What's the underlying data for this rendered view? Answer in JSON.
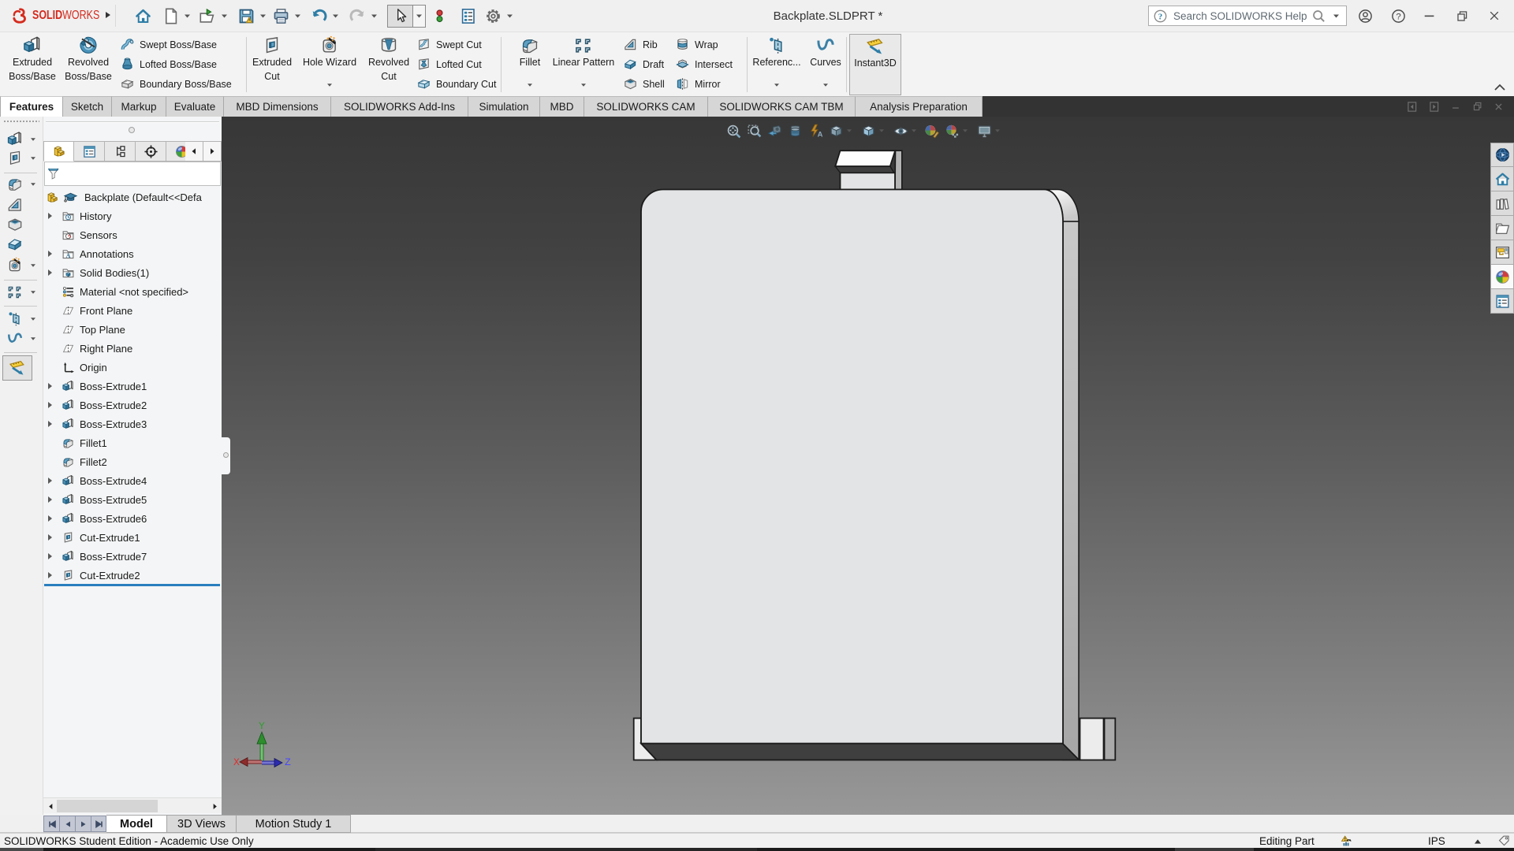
{
  "colors": {
    "brand_red": "#d52b1e",
    "rollback_blue": "#2a7fbe",
    "viewport_top": "#353535",
    "viewport_bottom": "#a6a6a6",
    "part": {
      "face": "#e3e4e6",
      "side_band": "#b4b4b4",
      "side_band_top": "#c9c9c9",
      "bottom_face": "#3f3f3f",
      "cap_top": "#fdfdfd",
      "flange": "#ececec",
      "outline": "#1a1a1a"
    },
    "triad": {
      "x_axis": "#c23b3b",
      "y_axis": "#2f9e2f",
      "z_axis": "#2b3bd0"
    }
  },
  "titlebar": {
    "brand_solid": "SOLID",
    "brand_works": "WORKS",
    "document_title": "Backplate.SLDPRT *",
    "search_placeholder": "Search SOLIDWORKS Help",
    "qat": [
      {
        "name": "home",
        "icon": "home",
        "dropdown": false
      },
      {
        "name": "new-document",
        "icon": "new-doc",
        "dropdown": true
      },
      {
        "name": "open",
        "icon": "open",
        "dropdown": true
      },
      {
        "name": "save",
        "icon": "save",
        "dropdown": true
      },
      {
        "name": "print",
        "icon": "print",
        "dropdown": true
      },
      {
        "name": "undo",
        "icon": "undo",
        "dropdown": true
      },
      {
        "name": "redo",
        "icon": "redo",
        "dropdown": true
      },
      {
        "name": "select",
        "icon": "cursor",
        "dropdown": true,
        "pressed": true
      },
      {
        "name": "display-states",
        "icon": "lights",
        "dropdown": false
      },
      {
        "name": "file-properties",
        "icon": "report",
        "dropdown": false
      },
      {
        "name": "options",
        "icon": "gear",
        "dropdown": true
      }
    ]
  },
  "ribbon": {
    "big_buttons": [
      {
        "name": "extruded-boss-base",
        "icon": "extruded-boss",
        "line1": "Extruded",
        "line2": "Boss/Base",
        "dropdown": false
      },
      {
        "name": "revolved-boss-base",
        "icon": "revolved-boss",
        "line1": "Revolved",
        "line2": "Boss/Base",
        "dropdown": false
      },
      {
        "name": "extruded-cut",
        "icon": "extruded-cut",
        "line1": "Extruded",
        "line2": "Cut",
        "dropdown": false
      },
      {
        "name": "hole-wizard",
        "icon": "hole-wizard",
        "line1": "Hole Wizard",
        "line2": "",
        "dropdown": true
      },
      {
        "name": "revolved-cut",
        "icon": "revolved-cut",
        "line1": "Revolved",
        "line2": "Cut",
        "dropdown": false
      },
      {
        "name": "fillet",
        "icon": "fillet",
        "line1": "Fillet",
        "line2": "",
        "dropdown": true
      },
      {
        "name": "linear-pattern",
        "icon": "linear-pattern",
        "line1": "Linear Pattern",
        "line2": "",
        "dropdown": true
      },
      {
        "name": "reference-geometry",
        "icon": "ref-geometry",
        "line1": "Referenc...",
        "line2": "",
        "dropdown": true
      },
      {
        "name": "curves",
        "icon": "curves",
        "line1": "Curves",
        "line2": "",
        "dropdown": true
      },
      {
        "name": "instant3d",
        "icon": "instant3d",
        "line1": "Instant3D",
        "line2": "",
        "dropdown": false,
        "pressed": true
      }
    ],
    "small_buttons": [
      {
        "name": "swept-boss-base",
        "icon": "swept-boss",
        "label": "Swept Boss/Base"
      },
      {
        "name": "lofted-boss-base",
        "icon": "lofted-boss",
        "label": "Lofted Boss/Base"
      },
      {
        "name": "boundary-boss-base",
        "icon": "boundary-boss",
        "label": "Boundary Boss/Base"
      },
      {
        "name": "swept-cut",
        "icon": "swept-cut",
        "label": "Swept Cut"
      },
      {
        "name": "lofted-cut",
        "icon": "lofted-cut",
        "label": "Lofted Cut"
      },
      {
        "name": "boundary-cut",
        "icon": "boundary-cut",
        "label": "Boundary Cut"
      },
      {
        "name": "rib",
        "icon": "rib",
        "label": "Rib"
      },
      {
        "name": "draft",
        "icon": "draft",
        "label": "Draft"
      },
      {
        "name": "shell",
        "icon": "shell",
        "label": "Shell"
      },
      {
        "name": "wrap",
        "icon": "wrap",
        "label": "Wrap"
      },
      {
        "name": "intersect",
        "icon": "intersect",
        "label": "Intersect"
      },
      {
        "name": "mirror",
        "icon": "mirror",
        "label": "Mirror"
      }
    ]
  },
  "cm_tabs": [
    {
      "label": "Features",
      "active": true
    },
    {
      "label": "Sketch",
      "active": false
    },
    {
      "label": "Markup",
      "active": false
    },
    {
      "label": "Evaluate",
      "active": false
    },
    {
      "label": "MBD Dimensions",
      "active": false
    },
    {
      "label": "SOLIDWORKS Add-Ins",
      "active": false
    },
    {
      "label": "Simulation",
      "active": false
    },
    {
      "label": "MBD",
      "active": false
    },
    {
      "label": "SOLIDWORKS CAM",
      "active": false
    },
    {
      "label": "SOLIDWORKS CAM TBM",
      "active": false
    },
    {
      "label": "Analysis Preparation",
      "active": false
    }
  ],
  "left_toolbar": [
    {
      "name": "extruded-boss-base",
      "icon": "extruded-boss",
      "dropdown": true
    },
    {
      "name": "extruded-cut",
      "icon": "extruded-cut",
      "dropdown": true
    },
    {
      "name": "fillet",
      "icon": "fillet",
      "dropdown": true
    },
    {
      "name": "rib",
      "icon": "rib",
      "dropdown": false
    },
    {
      "name": "shell",
      "icon": "shell",
      "dropdown": false
    },
    {
      "name": "draft",
      "icon": "draft",
      "dropdown": false
    },
    {
      "name": "hole-wizard",
      "icon": "hole-wizard",
      "dropdown": true
    },
    {
      "name": "linear-pattern",
      "icon": "linear-pattern",
      "dropdown": true
    },
    {
      "name": "reference-geometry",
      "icon": "ref-geometry",
      "dropdown": true
    },
    {
      "name": "curves",
      "icon": "curves",
      "dropdown": true
    },
    {
      "name": "instant3d",
      "icon": "instant3d",
      "dropdown": false,
      "pressed": true
    }
  ],
  "panel_tabs": [
    {
      "name": "featuremanager",
      "icon": "part-yellow",
      "active": true
    },
    {
      "name": "propertymanager",
      "icon": "property-form",
      "active": false
    },
    {
      "name": "configurationmanager",
      "icon": "config-tree",
      "active": false
    },
    {
      "name": "dimxpertmanager",
      "icon": "dimxpert-target",
      "active": false
    },
    {
      "name": "displaymanager",
      "icon": "display-colorwheel",
      "active": false
    }
  ],
  "feature_tree": {
    "root_label": "Backplate  (Default<<Defa",
    "items": [
      {
        "label": "History",
        "icon": "folder-history",
        "arrow": true
      },
      {
        "label": "Sensors",
        "icon": "folder-sensors",
        "arrow": false
      },
      {
        "label": "Annotations",
        "icon": "folder-annotations",
        "arrow": true
      },
      {
        "label": "Solid Bodies(1)",
        "icon": "folder-solid",
        "arrow": true
      },
      {
        "label": "Material <not specified>",
        "icon": "material",
        "arrow": false
      },
      {
        "label": "Front Plane",
        "icon": "plane",
        "arrow": false
      },
      {
        "label": "Top Plane",
        "icon": "plane",
        "arrow": false
      },
      {
        "label": "Right Plane",
        "icon": "plane",
        "arrow": false
      },
      {
        "label": "Origin",
        "icon": "origin",
        "arrow": false
      },
      {
        "label": "Boss-Extrude1",
        "icon": "boss-extrude",
        "arrow": true
      },
      {
        "label": "Boss-Extrude2",
        "icon": "boss-extrude",
        "arrow": true
      },
      {
        "label": "Boss-Extrude3",
        "icon": "boss-extrude",
        "arrow": true
      },
      {
        "label": "Fillet1",
        "icon": "fillet-feat",
        "arrow": false
      },
      {
        "label": "Fillet2",
        "icon": "fillet-feat",
        "arrow": false
      },
      {
        "label": "Boss-Extrude4",
        "icon": "boss-extrude",
        "arrow": true
      },
      {
        "label": "Boss-Extrude5",
        "icon": "boss-extrude",
        "arrow": true
      },
      {
        "label": "Boss-Extrude6",
        "icon": "boss-extrude",
        "arrow": true
      },
      {
        "label": "Cut-Extrude1",
        "icon": "cut-extrude",
        "arrow": true
      },
      {
        "label": "Boss-Extrude7",
        "icon": "boss-extrude",
        "arrow": true
      },
      {
        "label": "Cut-Extrude2",
        "icon": "cut-extrude",
        "arrow": true
      }
    ]
  },
  "hud": [
    {
      "name": "zoom-to-fit",
      "icon": "hud-zoomfit",
      "dropdown": false
    },
    {
      "name": "zoom-to-area",
      "icon": "hud-zoomarea",
      "dropdown": false
    },
    {
      "name": "previous-view",
      "icon": "hud-prevview",
      "dropdown": false
    },
    {
      "name": "section-view",
      "icon": "hud-section",
      "dropdown": false
    },
    {
      "name": "dynamic-annotation-views",
      "icon": "hud-annot",
      "dropdown": false
    },
    {
      "name": "view-orientation",
      "icon": "hud-vieworient",
      "dropdown": true
    },
    {
      "name": "display-style",
      "icon": "hud-displaystyle",
      "dropdown": true
    },
    {
      "name": "hide-show-items",
      "icon": "hud-eye",
      "dropdown": true
    },
    {
      "name": "edit-appearance",
      "icon": "hud-appearance",
      "dropdown": false
    },
    {
      "name": "apply-scene",
      "icon": "hud-scene",
      "dropdown": true
    },
    {
      "name": "view-settings",
      "icon": "hud-viewsettings",
      "dropdown": true
    }
  ],
  "taskpane": [
    {
      "name": "solidworks-resources",
      "icon": "tp-resources",
      "active": false
    },
    {
      "name": "home",
      "icon": "tp-home",
      "active": false
    },
    {
      "name": "design-library",
      "icon": "tp-library",
      "active": false
    },
    {
      "name": "file-explorer",
      "icon": "tp-explorer",
      "active": false
    },
    {
      "name": "view-palette",
      "icon": "tp-palette",
      "active": false
    },
    {
      "name": "appearances-scenes",
      "icon": "tp-appearances",
      "active": true
    },
    {
      "name": "custom-properties",
      "icon": "tp-props",
      "active": false
    }
  ],
  "doc_tabs": [
    {
      "label": "Model",
      "active": true
    },
    {
      "label": "3D Views",
      "active": false
    },
    {
      "label": "Motion Study 1",
      "active": false
    }
  ],
  "statusbar": {
    "left_text": "SOLIDWORKS Student Edition - Academic Use Only",
    "editing": "Editing Part",
    "units": "IPS"
  },
  "triad_labels": {
    "x": "X",
    "y": "Y",
    "z": "Z"
  }
}
